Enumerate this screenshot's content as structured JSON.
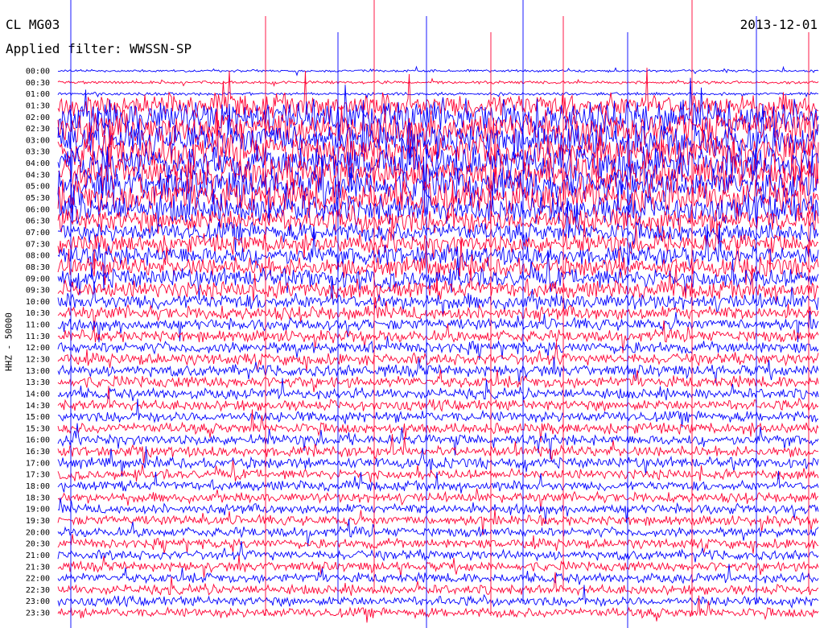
{
  "header": {
    "station": "CL MG03",
    "filter": "Applied filter: WWSSN-SP",
    "date": "2013-12-01"
  },
  "chart_data": {
    "type": "line",
    "title": "CL MG03",
    "subtitle": "Applied filter: WWSSN-SP",
    "date": "2013-12-01",
    "ylabel": "HHZ - 50000",
    "xlabel": "",
    "rows": [
      "00:00",
      "00:30",
      "01:00",
      "01:30",
      "02:00",
      "02:30",
      "03:00",
      "03:30",
      "04:00",
      "04:30",
      "05:00",
      "05:30",
      "06:00",
      "06:30",
      "07:00",
      "07:30",
      "08:00",
      "08:30",
      "09:00",
      "09:30",
      "10:00",
      "10:30",
      "11:00",
      "11:30",
      "12:00",
      "12:30",
      "13:00",
      "13:30",
      "14:00",
      "14:30",
      "15:00",
      "15:30",
      "16:00",
      "16:30",
      "17:00",
      "17:30",
      "18:00",
      "18:30",
      "19:00",
      "19:30",
      "20:00",
      "20:30",
      "21:00",
      "21:30",
      "22:00",
      "22:30",
      "23:00",
      "23:30"
    ],
    "row_minutes": 30,
    "trace_colors": [
      "#0000ff",
      "#ff0033"
    ],
    "amplitude_by_row": [
      0.25,
      0.3,
      0.3,
      2.5,
      3.5,
      3.5,
      3.5,
      3.5,
      3.5,
      3.5,
      3.5,
      3.5,
      3.0,
      2.5,
      2.0,
      2.0,
      2.0,
      2.0,
      2.0,
      1.8,
      1.6,
      1.4,
      1.2,
      1.2,
      1.2,
      1.2,
      1.2,
      1.2,
      1.1,
      1.1,
      1.1,
      1.1,
      1.1,
      1.1,
      1.1,
      1.0,
      1.0,
      1.0,
      1.0,
      1.0,
      1.0,
      1.0,
      1.0,
      1.0,
      1.0,
      1.0,
      1.0,
      1.0
    ],
    "grid": false,
    "legend": "none"
  }
}
